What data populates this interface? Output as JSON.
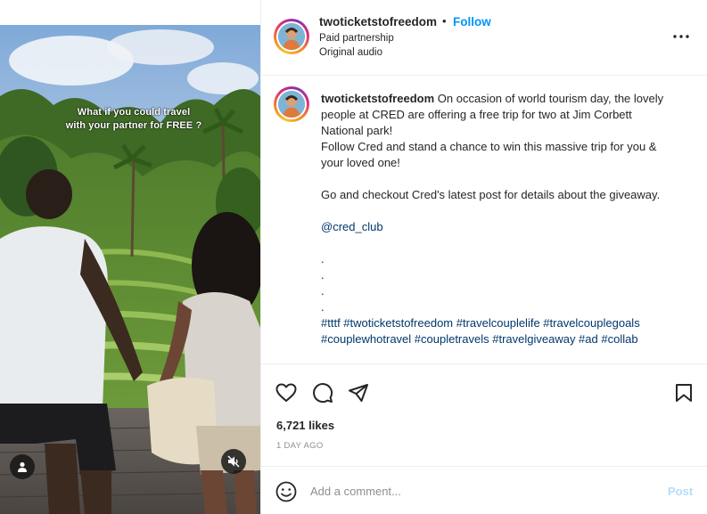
{
  "post": {
    "username": "twoticketstofreedom",
    "dot": "•",
    "follow_label": "Follow",
    "subtitle_1": "Paid partnership",
    "subtitle_2": "Original audio",
    "more_icon": "more-horizontal-icon"
  },
  "media": {
    "overlay_line_1": "What if you could travel",
    "overlay_line_2": "with your partner for FREE ?",
    "tag_icon": "user-tag-icon",
    "mute_icon": "muted-speaker-icon"
  },
  "caption": {
    "username": "twoticketstofreedom",
    "lines": [
      "On occasion of world tourism day, the lovely people at CRED are offering a free trip for two at Jim Corbett National park!",
      "Follow Cred and stand a chance to win this massive trip for you & your loved one!",
      "",
      "Go and checkout Cred's latest post for details about the giveaway.",
      ""
    ],
    "mention": "@cred_club",
    "dots": [
      ".",
      ".",
      ".",
      "."
    ],
    "hashtags": "#tttf #twoticketstofreedom #travelcouplelife #travelcouplegoals #couplewhotravel #coupletravels #travelgiveaway #ad #collab"
  },
  "actions": {
    "like_icon": "heart-icon",
    "comment_icon": "comment-icon",
    "share_icon": "send-icon",
    "save_icon": "bookmark-icon",
    "likes": "6,721 likes",
    "time": "1 DAY AGO"
  },
  "add_comment": {
    "emoji_icon": "emoji-icon",
    "placeholder": "Add a comment...",
    "post_label": "Post"
  },
  "colors": {
    "link_blue": "#0095f6",
    "post_disabled": "#b2dffc",
    "mention": "#00376b"
  }
}
